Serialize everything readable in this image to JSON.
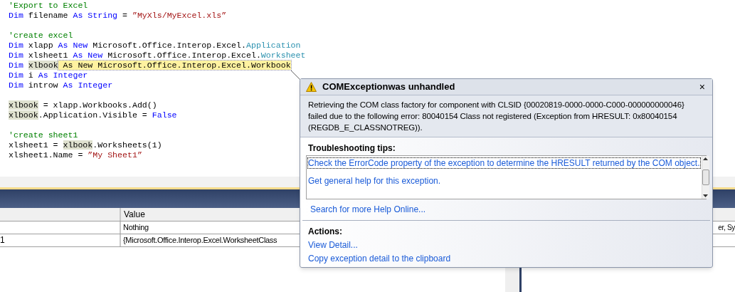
{
  "editor": {
    "lines": [
      {
        "tokens": [
          {
            "kind": "comment",
            "text": "'Export to Excel"
          }
        ]
      },
      {
        "tokens": [
          {
            "kind": "keyword",
            "text": "Dim"
          },
          {
            "kind": "plain",
            "text": " filename "
          },
          {
            "kind": "keyword",
            "text": "As String"
          },
          {
            "kind": "plain",
            "text": " = "
          },
          {
            "kind": "string",
            "text": "”MyXls/MyExcel.xls”"
          }
        ]
      },
      {
        "gap_before": true,
        "tokens": [
          {
            "kind": "comment",
            "text": "'create excel"
          }
        ]
      },
      {
        "tokens": [
          {
            "kind": "keyword",
            "text": "Dim"
          },
          {
            "kind": "plain",
            "text": " xlapp "
          },
          {
            "kind": "keyword",
            "text": "As New"
          },
          {
            "kind": "plain",
            "text": " Microsoft.Office.Interop.Excel."
          },
          {
            "kind": "type",
            "text": "Application"
          }
        ]
      },
      {
        "tokens": [
          {
            "kind": "keyword",
            "text": "Dim"
          },
          {
            "kind": "plain",
            "text": " xlsheet1 "
          },
          {
            "kind": "keyword",
            "text": "As New"
          },
          {
            "kind": "plain",
            "text": " Microsoft.Office.Interop.Excel."
          },
          {
            "kind": "type",
            "text": "Worksheet"
          }
        ]
      },
      {
        "tokens": [
          {
            "kind": "keyword",
            "text": "Dim "
          },
          {
            "kind": "reference",
            "text": "xlbook"
          },
          {
            "kind": "error",
            "text": " As New Microsoft.Office.Interop.Excel.Workbook"
          }
        ]
      },
      {
        "tokens": [
          {
            "kind": "keyword",
            "text": "Dim"
          },
          {
            "kind": "plain",
            "text": " i "
          },
          {
            "kind": "keyword",
            "text": "As Integer"
          }
        ]
      },
      {
        "tokens": [
          {
            "kind": "keyword",
            "text": "Dim"
          },
          {
            "kind": "plain",
            "text": " introw "
          },
          {
            "kind": "keyword",
            "text": "As Integer"
          }
        ]
      },
      {
        "gap_before": true,
        "tokens": [
          {
            "kind": "reference",
            "text": "xlbook"
          },
          {
            "kind": "plain",
            "text": " = xlapp.Workbooks.Add()"
          }
        ]
      },
      {
        "tokens": [
          {
            "kind": "reference",
            "text": "xlbook"
          },
          {
            "kind": "plain",
            "text": ".Application.Visible = "
          },
          {
            "kind": "keyword",
            "text": "False"
          }
        ]
      },
      {
        "gap_before": true,
        "tokens": [
          {
            "kind": "comment",
            "text": "'create sheet1"
          }
        ]
      },
      {
        "tokens": [
          {
            "kind": "plain",
            "text": "xlsheet1 = "
          },
          {
            "kind": "reference",
            "text": "xlbook"
          },
          {
            "kind": "plain",
            "text": ".Worksheets(1)"
          }
        ]
      },
      {
        "tokens": [
          {
            "kind": "plain",
            "text": "xlsheet1.Name = "
          },
          {
            "kind": "string",
            "text": "”My Sheet1”"
          }
        ]
      }
    ]
  },
  "watch": {
    "columns": [
      "Value"
    ],
    "rows": [
      {
        "value": "Nothing",
        "type": "er, Sy"
      },
      {
        "name": "1",
        "value": "{Microsoft.Office.Interop.Excel.WorksheetClass"
      }
    ]
  },
  "exception": {
    "title": "COMExceptionwas unhandled",
    "close": "×",
    "message": "Retrieving the COM class factory for component with CLSID {00020819-0000-0000-C000-000000000046} failed due to the following error: 80040154 Class not registered (Exception from HRESULT: 0x80040154 (REGDB_E_CLASSNOTREG)).",
    "tips_heading": "Troubleshooting tips:",
    "tips": [
      {
        "text": "Check the ErrorCode property of the exception to determine the HRESULT returned by the COM object.",
        "selected": true
      },
      {
        "text": "Get general help for this exception.",
        "selected": false
      }
    ],
    "search_link": "Search for more Help Online...",
    "actions_heading": "Actions:",
    "actions": [
      "View Detail...",
      "Copy exception detail to the clipboard"
    ]
  }
}
